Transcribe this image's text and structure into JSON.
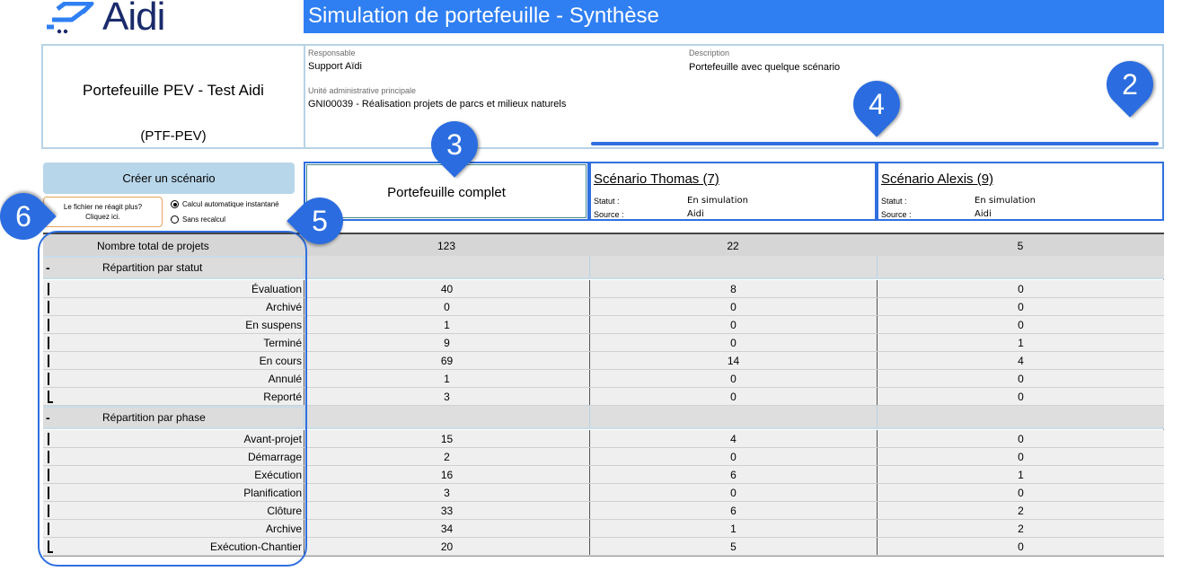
{
  "app": {
    "logo_text": "Aidi",
    "title": "Simulation de portefeuille - Synthèse"
  },
  "portfolio": {
    "name": "Portefeuille PEV - Test Aidi",
    "code": "(PTF-PEV)",
    "responsable_label": "Responsable",
    "responsable_value": "Support Aïdi",
    "unite_label": "Unité administrative principale",
    "unite_value": "GNI00039 - Réalisation projets de parcs et milieux naturels",
    "description_label": "Description",
    "description_value": "Portefeuille avec quelque scénario"
  },
  "controls": {
    "create_scenario": "Créer un scénario",
    "unresponsive_line1": "Le fichier ne réagit plus?",
    "unresponsive_line2": "Cliquez ici.",
    "radio_auto": "Calcul automatique instantané",
    "radio_manual": "Sans recalcul"
  },
  "columns": {
    "full": "Portefeuille complet",
    "scenarios": [
      {
        "title": "Scénario Thomas (7)",
        "statut_label": "Statut :",
        "statut": "En simulation",
        "source_label": "Source :",
        "source": "Aidi"
      },
      {
        "title": "Scénario Alexis (9)",
        "statut_label": "Statut :",
        "statut": "En simulation",
        "source_label": "Source :",
        "source": "Aidi"
      }
    ]
  },
  "grid": {
    "total": {
      "label": "Nombre total de projets",
      "values": [
        "123",
        "22",
        "5"
      ]
    },
    "sections": [
      {
        "label": "Répartition par statut",
        "rows": [
          {
            "label": "Évaluation",
            "values": [
              "40",
              "8",
              "0"
            ]
          },
          {
            "label": "Archivé",
            "values": [
              "0",
              "0",
              "0"
            ]
          },
          {
            "label": "En suspens",
            "values": [
              "1",
              "0",
              "0"
            ]
          },
          {
            "label": "Terminé",
            "values": [
              "9",
              "0",
              "1"
            ]
          },
          {
            "label": "En cours",
            "values": [
              "69",
              "14",
              "4"
            ]
          },
          {
            "label": "Annulé",
            "values": [
              "1",
              "0",
              "0"
            ]
          },
          {
            "label": "Reporté",
            "values": [
              "3",
              "0",
              "0"
            ]
          }
        ]
      },
      {
        "label": "Répartition par phase",
        "rows": [
          {
            "label": "Avant-projet",
            "values": [
              "15",
              "4",
              "0"
            ]
          },
          {
            "label": "Démarrage",
            "values": [
              "2",
              "0",
              "0"
            ]
          },
          {
            "label": "Exécution",
            "values": [
              "16",
              "6",
              "1"
            ]
          },
          {
            "label": "Planification",
            "values": [
              "3",
              "0",
              "0"
            ]
          },
          {
            "label": "Clôture",
            "values": [
              "33",
              "6",
              "2"
            ]
          },
          {
            "label": "Archive",
            "values": [
              "34",
              "1",
              "2"
            ]
          },
          {
            "label": "Exécution-Chantier",
            "values": [
              "20",
              "5",
              "0"
            ]
          }
        ]
      }
    ]
  },
  "callouts": [
    "2",
    "3",
    "4",
    "5",
    "6"
  ],
  "colors": {
    "title_bar": "#2f7ff3",
    "accent": "#2b6de0",
    "button": "#b8d6ea"
  }
}
